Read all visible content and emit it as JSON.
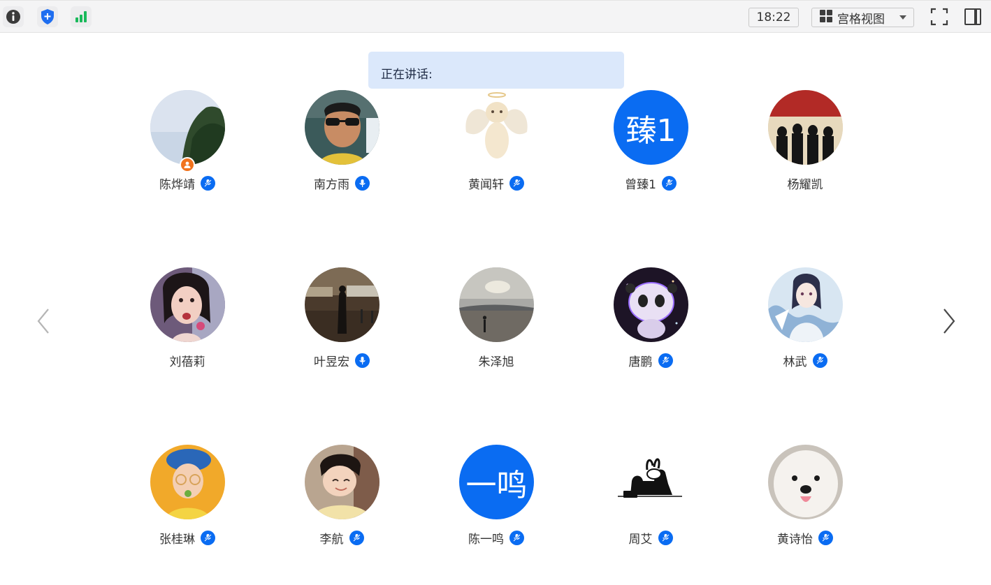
{
  "toolbar": {
    "clock": "18:22",
    "view_label": "宫格视图",
    "icons": [
      "info-icon",
      "shield-icon",
      "signal-icon",
      "grid-icon",
      "fullscreen-icon",
      "sidebar-toggle-icon"
    ]
  },
  "speaking": {
    "label": "正在讲话:"
  },
  "colors": {
    "accent": "#0a6cf2",
    "host_badge": "#f1731e",
    "speaking_bg": "#dbe8fb",
    "signal": "#19b95a"
  },
  "participants": [
    {
      "name": "陈烨靖",
      "avatar": "photo-sky-tree",
      "mic": "muted",
      "host": true
    },
    {
      "name": "南方雨",
      "avatar": "photo-man-sunglasses",
      "mic": "on",
      "host": false
    },
    {
      "name": "黄闻轩",
      "avatar": "photo-angel-cat",
      "mic": "muted",
      "host": false
    },
    {
      "name": "曾臻1",
      "avatar_text": "臻1",
      "mic": "muted",
      "host": false
    },
    {
      "name": "杨耀凯",
      "avatar": "photo-reservoir-dogs",
      "mic": "none",
      "host": false
    },
    {
      "name": "刘蓓莉",
      "avatar": "photo-girl-flower",
      "mic": "none",
      "host": false
    },
    {
      "name": "叶昱宏",
      "avatar": "photo-street-night",
      "mic": "on",
      "host": false
    },
    {
      "name": "朱泽旭",
      "avatar": "photo-beach-sunset",
      "mic": "none",
      "host": false
    },
    {
      "name": "唐鹏",
      "avatar": "photo-glowing-panda",
      "mic": "muted",
      "host": false
    },
    {
      "name": "林武",
      "avatar": "photo-anime-boy",
      "mic": "muted",
      "host": false
    },
    {
      "name": "张桂琳",
      "avatar": "photo-boy-yellow",
      "mic": "muted",
      "host": false
    },
    {
      "name": "李航",
      "avatar": "photo-child-smile",
      "mic": "muted",
      "host": false
    },
    {
      "name": "陈一鸣",
      "avatar_text": "一鸣",
      "mic": "muted",
      "host": false
    },
    {
      "name": "周艾",
      "avatar": "drawing-rabbit-sofa",
      "mic": "muted",
      "host": false
    },
    {
      "name": "黄诗怡",
      "avatar": "photo-white-dog",
      "mic": "muted",
      "host": false
    }
  ]
}
